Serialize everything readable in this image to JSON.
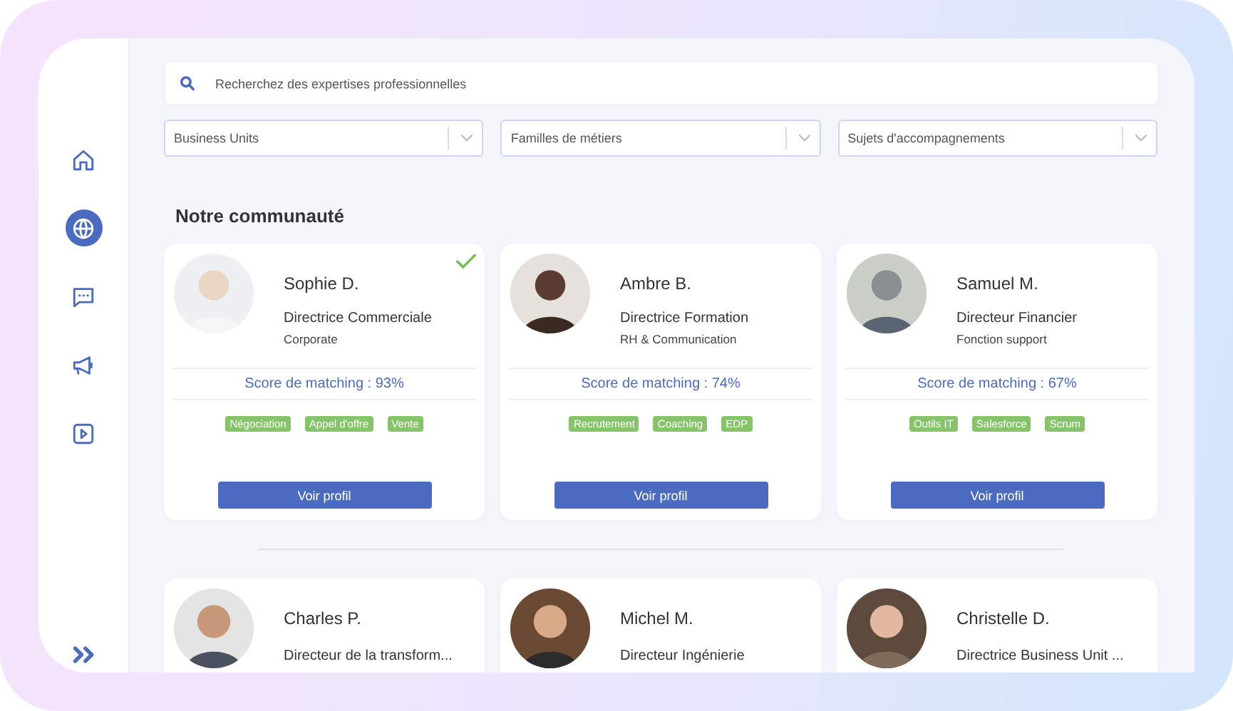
{
  "sidebar": {
    "items": [
      {
        "kind": "home",
        "selected": false
      },
      {
        "kind": "globe",
        "selected": true
      },
      {
        "kind": "chat",
        "selected": false
      },
      {
        "kind": "megaphone",
        "selected": false
      },
      {
        "kind": "play",
        "selected": false
      }
    ]
  },
  "search": {
    "placeholder": "Recherchez des expertises professionnelles"
  },
  "filters": [
    {
      "placeholder": "Business Units"
    },
    {
      "placeholder": "Familles de métiers"
    },
    {
      "placeholder": "Sujets d'accompagnements"
    }
  ],
  "section_title": "Notre communauté",
  "cards": [
    {
      "name": "Sophie D.",
      "title": "Directrice Commerciale",
      "department": "Corporate",
      "score": "Score de matching : 93%",
      "tags": [
        "Négociation",
        "Appel d'offre",
        "Vente"
      ],
      "button": "Voir profil",
      "checked": true
    },
    {
      "name": "Ambre B.",
      "title": "Directrice Formation",
      "department": "RH & Communication",
      "score": "Score de matching : 74%",
      "tags": [
        "Recrutement",
        "Coaching",
        "EDP"
      ],
      "button": "Voir profil",
      "checked": false
    },
    {
      "name": "Samuel M.",
      "title": "Directeur Financier",
      "department": "Fonction support",
      "score": "Score de matching : 67%",
      "tags": [
        "Outils IT",
        "Salesforce",
        "Scrum"
      ],
      "button": "Voir profil",
      "checked": false
    }
  ],
  "more_cards": [
    {
      "name": "Charles P.",
      "title": "Directeur de la transform..."
    },
    {
      "name": "Michel M.",
      "title": "Directeur Ingénierie"
    },
    {
      "name": "Christelle D.",
      "title": "Directrice Business Unit ..."
    }
  ]
}
